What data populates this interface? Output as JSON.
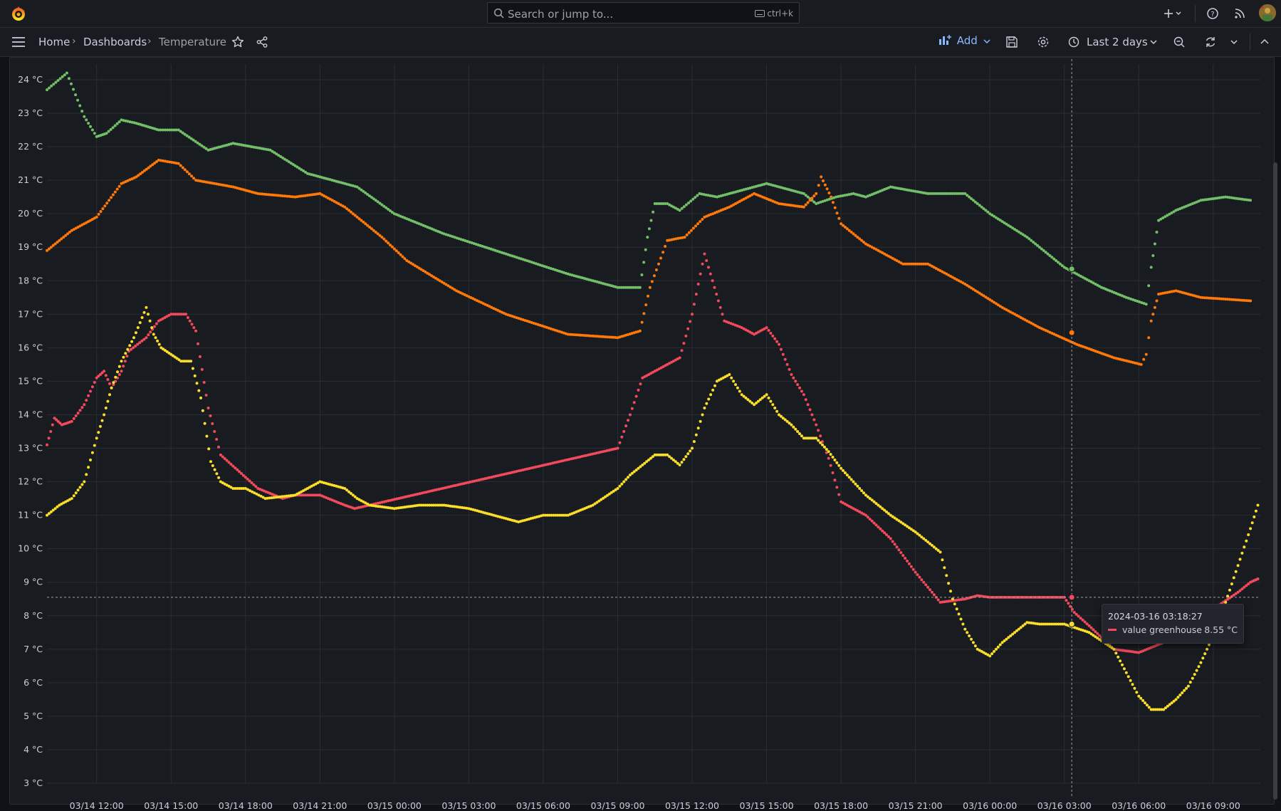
{
  "search": {
    "placeholder": "Search or jump to...",
    "shortcut": "ctrl+k"
  },
  "breadcrumb": {
    "home": "Home",
    "dashboards": "Dashboards",
    "current": "Temperature"
  },
  "toolbar": {
    "add_label": "Add",
    "time_range": "Last 2 days"
  },
  "colors": {
    "green": "#73bf69",
    "orange": "#ff780a",
    "red": "#f2495c",
    "yellow": "#fade2a",
    "background": "#181b1f",
    "grid": "#2a2d33",
    "accent": "#8ab8ff"
  },
  "tooltip": {
    "time": "2024-03-16 03:18:27",
    "series": "value greenhouse",
    "value": "8.55 °C"
  },
  "chart_data": {
    "type": "scatter",
    "ylabel": "",
    "unit": "°C",
    "ylim": [
      3,
      24.5
    ],
    "y_ticks": [
      "3 °C",
      "4 °C",
      "5 °C",
      "6 °C",
      "7 °C",
      "8 °C",
      "9 °C",
      "10 °C",
      "11 °C",
      "12 °C",
      "13 °C",
      "14 °C",
      "15 °C",
      "16 °C",
      "17 °C",
      "18 °C",
      "19 °C",
      "20 °C",
      "21 °C",
      "22 °C",
      "23 °C",
      "24 °C"
    ],
    "x_ticks": [
      "03/14 12:00",
      "03/14 15:00",
      "03/14 18:00",
      "03/14 21:00",
      "03/15 00:00",
      "03/15 03:00",
      "03/15 06:00",
      "03/15 09:00",
      "03/15 12:00",
      "03/15 15:00",
      "03/15 18:00",
      "03/15 21:00",
      "03/16 00:00",
      "03/16 03:00",
      "03/16 06:00",
      "03/16 09:00"
    ],
    "x_tick_hours": [
      12,
      15,
      18,
      21,
      24,
      27,
      30,
      33,
      36,
      39,
      42,
      45,
      48,
      51,
      54,
      57
    ],
    "xlim_hours": [
      10.0,
      58.9
    ],
    "x_unit": "hours since 03/14 00:00",
    "series": [
      {
        "color": "#73bf69",
        "x": [
          10.0,
          10.8,
          11.5,
          12.0,
          12.4,
          13.0,
          13.6,
          14.5,
          15.3,
          16.5,
          17.5,
          19.0,
          20.5,
          22.5,
          24.0,
          26.0,
          28.5,
          31.0,
          33.0,
          33.9,
          34.2,
          34.5,
          35.0,
          35.5,
          36.3,
          37.0,
          38.0,
          39.0,
          40.5,
          41.0,
          41.8,
          42.5,
          43.0,
          44.0,
          45.5,
          47.0,
          48.0,
          49.5,
          51.0,
          52.5,
          53.5,
          54.3,
          54.5,
          54.8,
          55.5,
          56.5,
          57.5,
          58.5
        ],
        "y": [
          23.7,
          24.2,
          22.9,
          22.3,
          22.4,
          22.8,
          22.7,
          22.5,
          22.5,
          21.9,
          22.1,
          21.9,
          21.2,
          20.8,
          20.0,
          19.4,
          18.8,
          18.2,
          17.8,
          17.8,
          19.3,
          20.3,
          20.3,
          20.1,
          20.6,
          20.5,
          20.7,
          20.9,
          20.6,
          20.3,
          20.5,
          20.6,
          20.5,
          20.8,
          20.6,
          20.6,
          20.0,
          19.3,
          18.4,
          17.8,
          17.5,
          17.3,
          18.4,
          19.8,
          20.1,
          20.4,
          20.5,
          20.4
        ]
      },
      {
        "color": "#ff780a",
        "x": [
          10.0,
          11.0,
          12.0,
          13.0,
          13.6,
          14.5,
          15.3,
          16.0,
          17.5,
          18.5,
          20.0,
          21.0,
          22.0,
          23.5,
          24.5,
          26.5,
          28.5,
          31.0,
          33.0,
          33.9,
          34.3,
          35.0,
          35.7,
          36.5,
          37.5,
          38.5,
          39.5,
          40.5,
          41.0,
          41.2,
          41.6,
          42.0,
          43.0,
          44.5,
          45.5,
          47.0,
          48.5,
          50.0,
          51.5,
          53.0,
          54.1,
          54.3,
          54.5,
          54.8,
          55.5,
          56.5,
          58.5
        ],
        "y": [
          18.9,
          19.5,
          19.9,
          20.9,
          21.1,
          21.6,
          21.5,
          21.0,
          20.8,
          20.6,
          20.5,
          20.6,
          20.2,
          19.3,
          18.6,
          17.7,
          17.0,
          16.4,
          16.3,
          16.5,
          17.8,
          19.2,
          19.3,
          19.9,
          20.2,
          20.6,
          20.3,
          20.2,
          20.6,
          21.1,
          20.5,
          19.7,
          19.1,
          18.5,
          18.5,
          17.9,
          17.2,
          16.6,
          16.1,
          15.7,
          15.5,
          15.8,
          16.8,
          17.6,
          17.7,
          17.5,
          17.4
        ]
      },
      {
        "name": "value greenhouse",
        "color": "#f2495c",
        "x": [
          10.0,
          10.3,
          10.6,
          11.0,
          11.5,
          12.0,
          12.3,
          12.6,
          13.0,
          13.3,
          14.0,
          14.5,
          15.0,
          15.6,
          16.0,
          16.5,
          17.0,
          18.5,
          19.5,
          20.0,
          21.0,
          22.0,
          22.4,
          33.0,
          33.5,
          34.0,
          34.5,
          35.0,
          35.5,
          36.0,
          36.5,
          36.9,
          37.3,
          38.0,
          38.5,
          39.0,
          39.5,
          40.0,
          40.5,
          41.0,
          41.5,
          42.0,
          43.0,
          44.0,
          45.0,
          46.0,
          47.0,
          47.5,
          48.0,
          49.0,
          50.0,
          51.0,
          51.4,
          52.0,
          53.0,
          54.0,
          55.0,
          56.0,
          56.5,
          57.0,
          58.0,
          58.5,
          58.8
        ],
        "y": [
          13.1,
          13.9,
          13.7,
          13.8,
          14.3,
          15.1,
          15.3,
          14.8,
          15.3,
          15.9,
          16.3,
          16.8,
          17.0,
          17.0,
          16.5,
          14.2,
          12.8,
          11.8,
          11.5,
          11.6,
          11.6,
          11.3,
          11.2,
          13.0,
          14.0,
          15.1,
          15.3,
          15.5,
          15.7,
          17.0,
          18.8,
          17.8,
          16.8,
          16.6,
          16.4,
          16.6,
          16.1,
          15.2,
          14.6,
          13.7,
          12.7,
          11.4,
          11.0,
          10.3,
          9.3,
          8.4,
          8.5,
          8.6,
          8.55,
          8.55,
          8.55,
          8.55,
          8.1,
          7.7,
          7.0,
          6.9,
          7.2,
          7.5,
          7.8,
          8.2,
          8.7,
          9.0,
          9.1
        ]
      },
      {
        "color": "#fade2a",
        "x": [
          10.0,
          10.5,
          11.0,
          11.5,
          12.0,
          12.3,
          12.6,
          13.0,
          13.5,
          14.0,
          14.3,
          14.6,
          15.0,
          15.4,
          15.8,
          16.2,
          16.6,
          17.0,
          17.5,
          18.0,
          18.8,
          20.0,
          20.5,
          21.0,
          22.0,
          22.5,
          23.0,
          24.0,
          25.0,
          26.0,
          27.0,
          28.0,
          29.0,
          30.0,
          31.0,
          32.0,
          33.0,
          33.5,
          34.0,
          34.5,
          35.0,
          35.5,
          36.0,
          36.5,
          37.0,
          37.5,
          38.0,
          38.5,
          39.0,
          39.5,
          40.0,
          40.5,
          41.0,
          41.5,
          42.0,
          43.0,
          44.0,
          45.0,
          46.0,
          46.5,
          47.0,
          47.5,
          48.0,
          48.5,
          49.0,
          49.5,
          50.0,
          51.0,
          52.0,
          53.0,
          53.5,
          54.0,
          54.5,
          55.0,
          55.5,
          56.0,
          56.5,
          57.0,
          57.5,
          58.0,
          58.5,
          58.8
        ],
        "y": [
          11.0,
          11.3,
          11.5,
          12.0,
          13.3,
          14.0,
          14.8,
          15.6,
          16.3,
          17.2,
          16.4,
          16.0,
          15.8,
          15.6,
          15.6,
          14.5,
          12.6,
          12.0,
          11.8,
          11.8,
          11.5,
          11.6,
          11.8,
          12.0,
          11.8,
          11.5,
          11.3,
          11.2,
          11.3,
          11.3,
          11.2,
          11.0,
          10.8,
          11.0,
          11.0,
          11.3,
          11.8,
          12.2,
          12.5,
          12.8,
          12.8,
          12.5,
          13.0,
          14.2,
          15.0,
          15.2,
          14.6,
          14.3,
          14.6,
          14.0,
          13.7,
          13.3,
          13.3,
          12.9,
          12.4,
          11.6,
          11.0,
          10.5,
          9.9,
          8.5,
          7.6,
          7.0,
          6.8,
          7.2,
          7.5,
          7.8,
          7.75,
          7.75,
          7.5,
          7.0,
          6.3,
          5.6,
          5.2,
          5.2,
          5.5,
          5.9,
          6.6,
          7.4,
          8.4,
          9.5,
          10.6,
          11.3
        ]
      }
    ]
  }
}
